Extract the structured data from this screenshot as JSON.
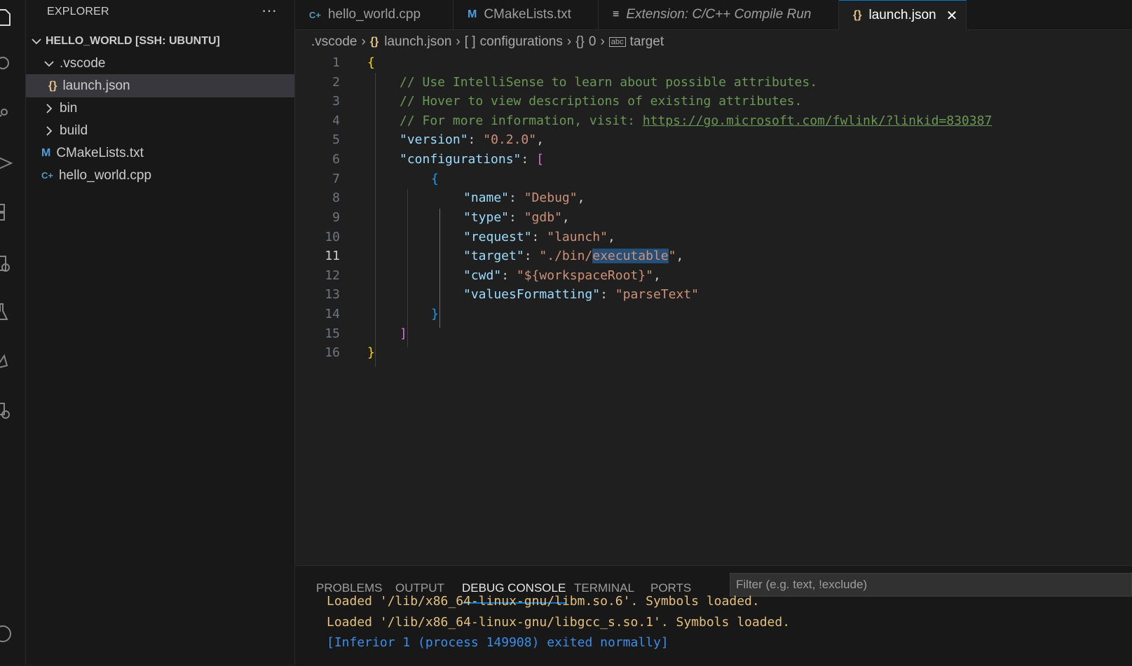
{
  "activity_bar": {
    "icons": [
      "explorer-icon",
      "search-icon",
      "source-control-icon",
      "run-debug-icon",
      "extensions-icon",
      "remote-explorer-icon",
      "testing-icon",
      "cmake-icon",
      "settings-gear-icon",
      "account-icon"
    ]
  },
  "sidebar": {
    "title": "EXPLORER",
    "more": "···",
    "root": "HELLO_WORLD [SSH: UBUNTU]",
    "items": [
      {
        "label": ".vscode",
        "type": "folder",
        "expanded": true
      },
      {
        "label": "launch.json",
        "type": "json",
        "icon": "{}"
      },
      {
        "label": "bin",
        "type": "folder",
        "expanded": false
      },
      {
        "label": "build",
        "type": "folder",
        "expanded": false
      },
      {
        "label": "CMakeLists.txt",
        "type": "cmake",
        "icon": "M"
      },
      {
        "label": "hello_world.cpp",
        "type": "cpp",
        "icon": "C+"
      }
    ]
  },
  "tabs": [
    {
      "label": "hello_world.cpp",
      "icon": "C+"
    },
    {
      "label": "CMakeLists.txt",
      "icon": "M"
    },
    {
      "label": "Extension: C/C++ Compile Run",
      "icon": "≡"
    },
    {
      "label": "launch.json",
      "icon": "{}",
      "close": "✕"
    }
  ],
  "breadcrumb": [
    ".vscode",
    "launch.json",
    "configurations",
    "0",
    "target"
  ],
  "editor": {
    "line_numbers": [
      "1",
      "2",
      "3",
      "4",
      "5",
      "6",
      "7",
      "8",
      "9",
      "10",
      "11",
      "12",
      "13",
      "14",
      "15",
      "16"
    ],
    "current_line": "11",
    "lines": {
      "l1": "{",
      "l2": "// Use IntelliSense to learn about possible attributes.",
      "l3": "// Hover to view descriptions of existing attributes.",
      "l4_prefix": "// For more information, visit: ",
      "l4_link": "https://go.microsoft.com/fwlink/?linkid=830387",
      "l5_key": "\"version\"",
      "l5_val": "\"0.2.0\"",
      "l6_key": "\"configurations\"",
      "l6_open": "[",
      "l7": "{",
      "l8_key": "\"name\"",
      "l8_val": "\"Debug\"",
      "l9_key": "\"type\"",
      "l9_val": "\"gdb\"",
      "l10_key": "\"request\"",
      "l10_val": "\"launch\"",
      "l11_key": "\"target\"",
      "l11_val_a": "\"./bin/",
      "l11_val_sel": "executable",
      "l11_val_b": "\"",
      "l12_key": "\"cwd\"",
      "l12_val": "\"${workspaceRoot}\"",
      "l13_key": "\"valuesFormatting\"",
      "l13_val": "\"parseText\"",
      "l14": "}",
      "l15": "]",
      "l16": "}"
    }
  },
  "panel": {
    "tabs": [
      "PROBLEMS",
      "OUTPUT",
      "DEBUG CONSOLE",
      "TERMINAL",
      "PORTS"
    ],
    "active_tab": "DEBUG CONSOLE",
    "filter_placeholder": "Filter (e.g. text, !exclude)",
    "lines": [
      "Loaded '/lib/x86_64-linux-gnu/libm.so.6'. Symbols loaded.",
      "Loaded '/lib/x86_64-linux-gnu/libgcc_s.so.1'. Symbols loaded.",
      "[Inferior 1 (process 149908) exited normally]"
    ]
  }
}
